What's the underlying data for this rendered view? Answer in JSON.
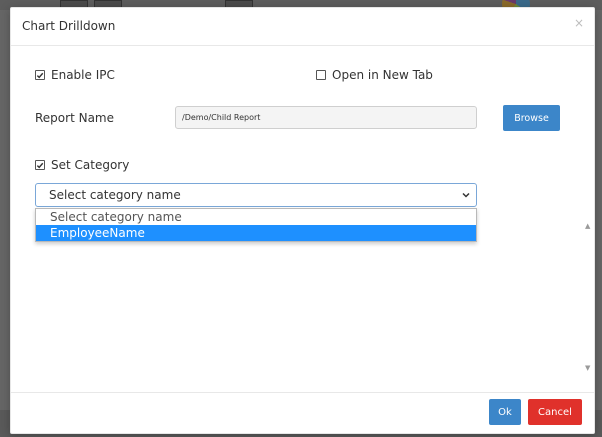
{
  "modal": {
    "title": "Chart Drilldown",
    "close_glyph": "×"
  },
  "options": {
    "enable_ipc": {
      "label": "Enable IPC",
      "checked": true
    },
    "open_new_tab": {
      "label": "Open in New Tab",
      "checked": false
    },
    "set_category": {
      "label": "Set Category",
      "checked": true
    }
  },
  "report": {
    "label": "Report Name",
    "value": "/Demo/Child Report",
    "browse_label": "Browse"
  },
  "category": {
    "selected": "Select category name",
    "options": [
      "Select category name",
      "EmployeeName"
    ],
    "highlighted_index": 1
  },
  "footer": {
    "ok_label": "Ok",
    "cancel_label": "Cancel"
  },
  "colors": {
    "primary": "#3c86c9",
    "danger": "#e0312b",
    "highlight": "#1e90ff"
  }
}
